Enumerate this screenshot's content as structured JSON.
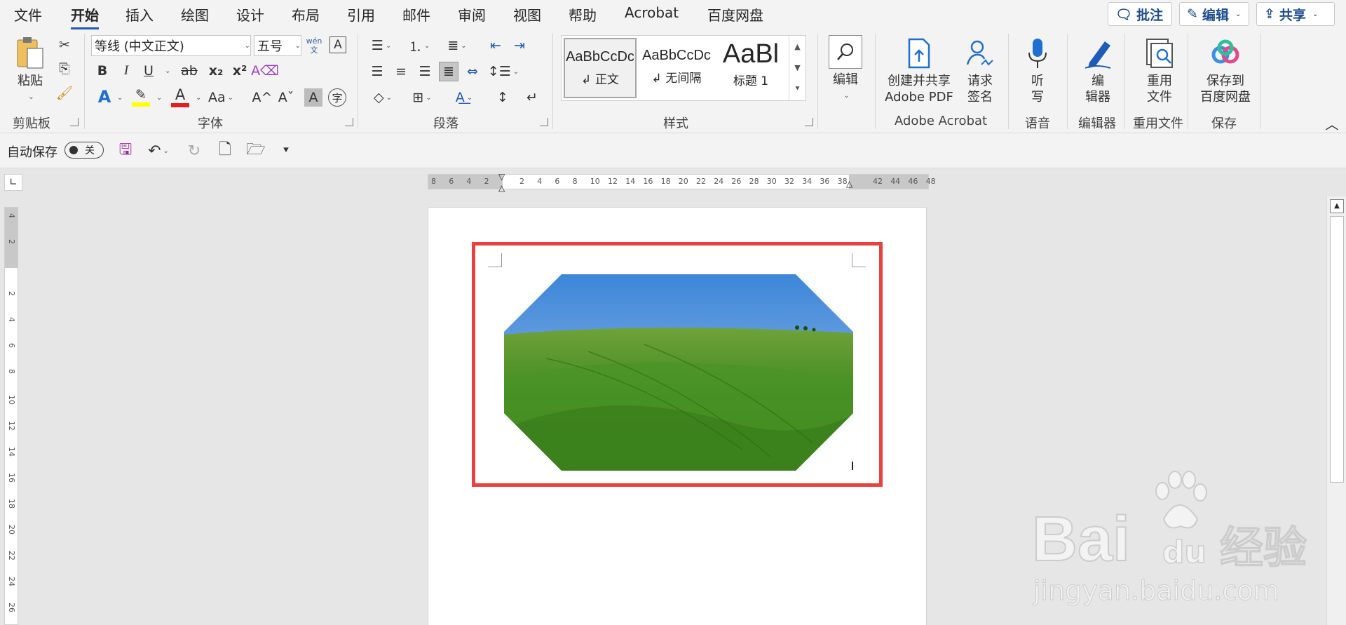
{
  "tabs": [
    "文件",
    "开始",
    "插入",
    "绘图",
    "设计",
    "布局",
    "引用",
    "邮件",
    "审阅",
    "视图",
    "帮助",
    "Acrobat",
    "百度网盘"
  ],
  "top_buttons": {
    "comment": "批注",
    "edit": "编辑",
    "share": "共享"
  },
  "clipboard": {
    "paste": "粘贴",
    "group": "剪贴板"
  },
  "font": {
    "name": "等线 (中文正文)",
    "size": "五号",
    "phonetic_top": "wén",
    "phonetic_bottom": "文",
    "group": "字体",
    "bold": "B",
    "italic": "I",
    "underline": "U",
    "strike": "ab",
    "sub": "x₂",
    "sup": "x²",
    "case": "Aa",
    "grow": "A^",
    "shrink": "Aˇ",
    "char_shading": "A",
    "enclose": "字"
  },
  "paragraph": {
    "group": "段落"
  },
  "styles": {
    "group": "样式",
    "items": [
      {
        "preview": "AaBbCcDc",
        "label": "↲ 正文"
      },
      {
        "preview": "AaBbCcDc",
        "label": "↲ 无间隔"
      },
      {
        "preview": "AaBl",
        "label": "标题 1"
      }
    ]
  },
  "editing": {
    "label": "编辑"
  },
  "acrobat": {
    "create_share_line1": "创建并共享",
    "create_share_line2": "Adobe PDF",
    "request_sign_line1": "请求",
    "request_sign_line2": "签名",
    "group": "Adobe Acrobat"
  },
  "voice": {
    "dictate_line1": "听",
    "dictate_line2": "写",
    "group": "语音"
  },
  "editor": {
    "line1": "编",
    "line2": "辑器",
    "group": "编辑器"
  },
  "reuse": {
    "line1": "重用",
    "line2": "文件",
    "group": "重用文件"
  },
  "save": {
    "line1": "保存到",
    "line2": "百度网盘",
    "group": "保存"
  },
  "qat": {
    "autosave": "自动保存",
    "toggle": "关"
  },
  "ruler_h": [
    "8",
    "6",
    "4",
    "2",
    "",
    "2",
    "4",
    "6",
    "8",
    "10",
    "12",
    "14",
    "16",
    "18",
    "20",
    "22",
    "24",
    "26",
    "28",
    "30",
    "32",
    "34",
    "36",
    "38",
    "",
    "42",
    "44",
    "46",
    "48"
  ],
  "ruler_v": [
    "4",
    "2",
    "",
    "2",
    "4",
    "6",
    "8",
    "10",
    "12",
    "14",
    "16",
    "18",
    "20",
    "22",
    "24",
    "26"
  ],
  "watermark": {
    "main": "Bai",
    "du": "du",
    "cn": "经验",
    "url": "jingyan.baidu.com"
  },
  "colors": {
    "accent": "#1f5bb8",
    "selection": "#e8413f",
    "highlight": "#ffff00",
    "font_color": "#e02020"
  }
}
